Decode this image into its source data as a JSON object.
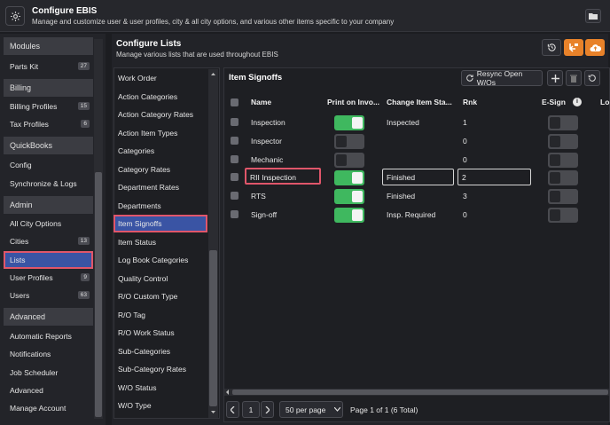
{
  "header": {
    "title": "Configure EBIS",
    "subtitle": "Manage and customize user & user profiles, city & all city options, and various other items specific to your company"
  },
  "sidebar": {
    "items": [
      {
        "type": "section",
        "label": "Modules"
      },
      {
        "type": "item",
        "label": "Parts Kit",
        "badge": "27"
      },
      {
        "type": "section",
        "label": "Billing"
      },
      {
        "type": "item",
        "label": "Billing Profiles",
        "badge": "15"
      },
      {
        "type": "item",
        "label": "Tax Profiles",
        "badge": "6"
      },
      {
        "type": "section",
        "label": "QuickBooks"
      },
      {
        "type": "item",
        "label": "Config"
      },
      {
        "type": "item",
        "label": "Synchronize & Logs"
      },
      {
        "type": "section",
        "label": "Admin"
      },
      {
        "type": "item",
        "label": "All City Options"
      },
      {
        "type": "item",
        "label": "Cities",
        "badge": "13"
      },
      {
        "type": "item",
        "label": "Lists",
        "active": true
      },
      {
        "type": "item",
        "label": "User Profiles",
        "badge": "9"
      },
      {
        "type": "item",
        "label": "Users",
        "badge": "63"
      },
      {
        "type": "section",
        "label": "Advanced"
      },
      {
        "type": "item",
        "label": "Automatic Reports"
      },
      {
        "type": "item",
        "label": "Notifications"
      },
      {
        "type": "item",
        "label": "Job Scheduler"
      },
      {
        "type": "item",
        "label": "Advanced"
      },
      {
        "type": "item",
        "label": "Manage Account"
      }
    ]
  },
  "configure_lists": {
    "title": "Configure Lists",
    "subtitle": "Manage various lists that are used throughout EBIS"
  },
  "lists": {
    "items": [
      "Work Order",
      "Action Categories",
      "Action Category Rates",
      "Action Item Types",
      "Categories",
      "Category Rates",
      "Department Rates",
      "Departments",
      "Item Signoffs",
      "Item Status",
      "Log Book Categories",
      "Quality Control",
      "R/O Custom Type",
      "R/O Tag",
      "R/O Work Status",
      "Sub-Categories",
      "Sub-Category Rates",
      "W/O Status",
      "W/O Type"
    ],
    "active": "Item Signoffs"
  },
  "grid": {
    "title": "Item Signoffs",
    "resync_label": "Resync Open W/Os",
    "columns": [
      "Name",
      "Print on Invo...",
      "Change Item Sta...",
      "Rnk",
      "E-Sign",
      "Lo"
    ],
    "rows": [
      {
        "name": "Inspection",
        "print": true,
        "change_status": "Inspected",
        "rank": "1",
        "esign": false
      },
      {
        "name": "Inspector",
        "print": false,
        "change_status": "",
        "rank": "0",
        "esign": false
      },
      {
        "name": "Mechanic",
        "print": false,
        "change_status": "",
        "rank": "0",
        "esign": false
      },
      {
        "name": "RII Inspection",
        "print": true,
        "change_status": "Finished",
        "rank": "2",
        "esign": false,
        "editing": true
      },
      {
        "name": "RTS",
        "print": true,
        "change_status": "Finished",
        "rank": "3",
        "esign": false
      },
      {
        "name": "Sign-off",
        "print": true,
        "change_status": "Insp. Required",
        "rank": "0",
        "esign": false
      }
    ]
  },
  "pagination": {
    "page": "1",
    "per_page": "50 per page",
    "info": "Page 1 of 1 (6 Total)"
  },
  "colors": {
    "accent_orange": "#e8822a",
    "active_blue": "#3a54a4",
    "toggle_green": "#3fb85f",
    "highlight_red": "#e0566a"
  }
}
